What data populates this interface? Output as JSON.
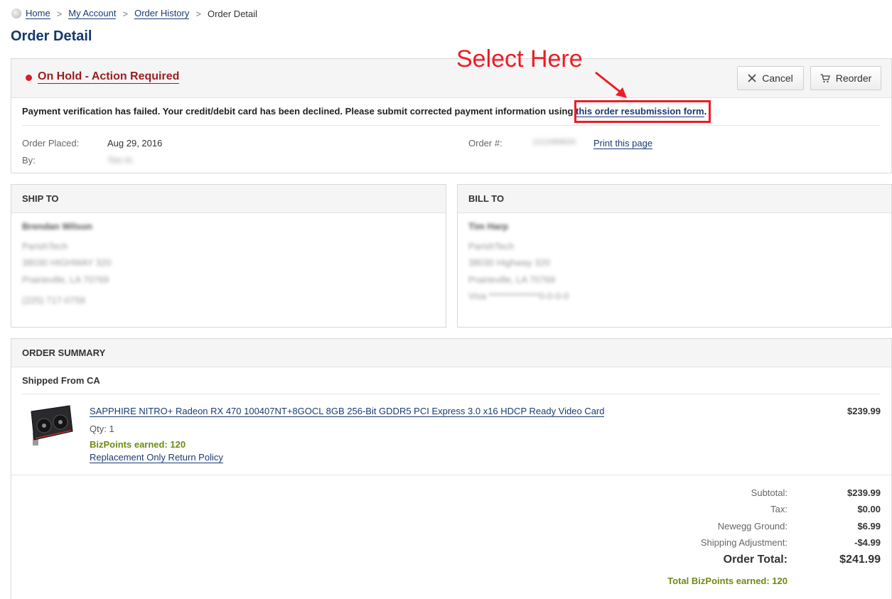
{
  "breadcrumb": {
    "home": "Home",
    "account": "My Account",
    "history": "Order History",
    "current": "Order Detail",
    "sep": ">"
  },
  "page_title": "Order Detail",
  "status": {
    "title": "On Hold - Action Required",
    "cancel_label": "Cancel",
    "reorder_label": "Reorder",
    "message": "Payment verification has failed. Your credit/debit card has been declined. Please submit corrected payment information using ",
    "message_link": "this order resubmission form",
    "message_end": "."
  },
  "order_meta": {
    "placed_label": "Order Placed:",
    "placed_value": "Aug 29, 2016",
    "by_label": "By:",
    "by_value": "Tim H.",
    "number_label": "Order #:",
    "number_value": "1212469620",
    "print_label": "Print this page"
  },
  "ship_to": {
    "title": "SHIP TO",
    "name": "Brendan Wilson",
    "company": "ParishTech",
    "street": "38030 HIGHWAY 320",
    "city": "Prairieville, LA 70769",
    "phone": "(225) 717-0759"
  },
  "bill_to": {
    "title": "BILL TO",
    "name": "Tim Harp",
    "company": "ParishTech",
    "street": "38030 Highway 320",
    "city": "Prairieville, LA 70769",
    "card": "Visa **************0-0-0-0"
  },
  "summary": {
    "title": "ORDER SUMMARY",
    "shipped_from": "Shipped From CA",
    "item": {
      "name": "SAPPHIRE NITRO+ Radeon RX 470 100407NT+8GOCL 8GB 256-Bit GDDR5 PCI Express 3.0 x16 HDCP Ready Video Card",
      "qty": "Qty: 1",
      "bizpoints": "BizPoints earned: 120",
      "policy": "Replacement Only Return Policy",
      "price": "$239.99"
    },
    "totals": {
      "subtotal_label": "Subtotal:",
      "subtotal_value": "$239.99",
      "tax_label": "Tax:",
      "tax_value": "$0.00",
      "shipping_label": "Newegg Ground:",
      "shipping_value": "$6.99",
      "adjust_label": "Shipping Adjustment:",
      "adjust_value": "-$4.99",
      "total_label": "Order Total:",
      "total_value": "$241.99",
      "bizpoints_total": "Total BizPoints earned: 120"
    }
  },
  "annotation": {
    "text": "Select Here",
    "color": "#ee1c24"
  },
  "colors": {
    "link": "#1b3a73",
    "title": "#15386b",
    "status_red": "#9b1d1d",
    "bizpoints_green": "#6f8a13"
  }
}
